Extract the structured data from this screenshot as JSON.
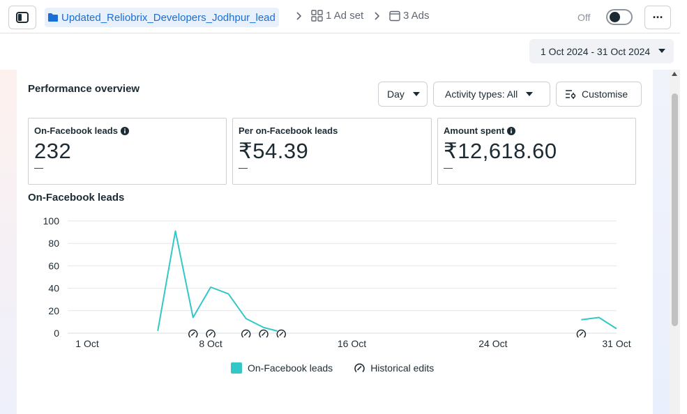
{
  "topbar": {
    "campaign_name": "Updated_Reliobrix_Developers_Jodhpur_lead",
    "ad_set_label": "1 Ad set",
    "ads_label": "3 Ads",
    "status_label": "Off",
    "more_label": "···",
    "icons": [
      "sidebar-icon",
      "folder-icon",
      "grid-icon",
      "ad-icon",
      "chevron-right-icon"
    ]
  },
  "date_range": {
    "label": "1 Oct 2024 - 31 Oct 2024"
  },
  "overview": {
    "title": "Performance overview",
    "day_label": "Day",
    "activity_label": "Activity types: All",
    "customise_label": "Customise"
  },
  "metrics": [
    {
      "label": "On-Facebook leads",
      "value": "232",
      "delta": "—",
      "has_info": true
    },
    {
      "label": "Per on-Facebook leads",
      "value": "₹54.39",
      "delta": "—",
      "has_info": false
    },
    {
      "label": "Amount spent",
      "value": "₹12,618.60",
      "delta": "—",
      "has_info": true
    }
  ],
  "chart_title": "On-Facebook leads",
  "chart_data": {
    "type": "line",
    "title": "On-Facebook leads",
    "xlabel": "",
    "ylabel": "",
    "x_ticks": [
      1,
      8,
      16,
      24,
      31
    ],
    "x_tick_labels": [
      "1 Oct",
      "8 Oct",
      "16 Oct",
      "24 Oct",
      "31 Oct"
    ],
    "y_ticks": [
      0,
      20,
      40,
      60,
      80,
      100
    ],
    "ylim": [
      0,
      100
    ],
    "xlim": [
      1,
      31
    ],
    "grid": true,
    "series": [
      {
        "name": "On-Facebook leads",
        "color": "#33c7c7",
        "segments": [
          {
            "x": [
              5,
              6,
              7,
              8,
              9,
              10,
              11,
              12
            ],
            "y": [
              2,
              91,
              14,
              41,
              35,
              13,
              5,
              1
            ]
          },
          {
            "x": [
              29,
              30,
              31
            ],
            "y": [
              12,
              14,
              4
            ]
          }
        ]
      }
    ],
    "historical_edits": [
      7,
      8,
      10,
      11,
      12,
      29
    ],
    "legend": [
      "On-Facebook leads",
      "Historical edits"
    ],
    "legend_position": "bottom"
  },
  "legend": {
    "leads_label": "On-Facebook leads",
    "edits_label": "Historical edits"
  }
}
